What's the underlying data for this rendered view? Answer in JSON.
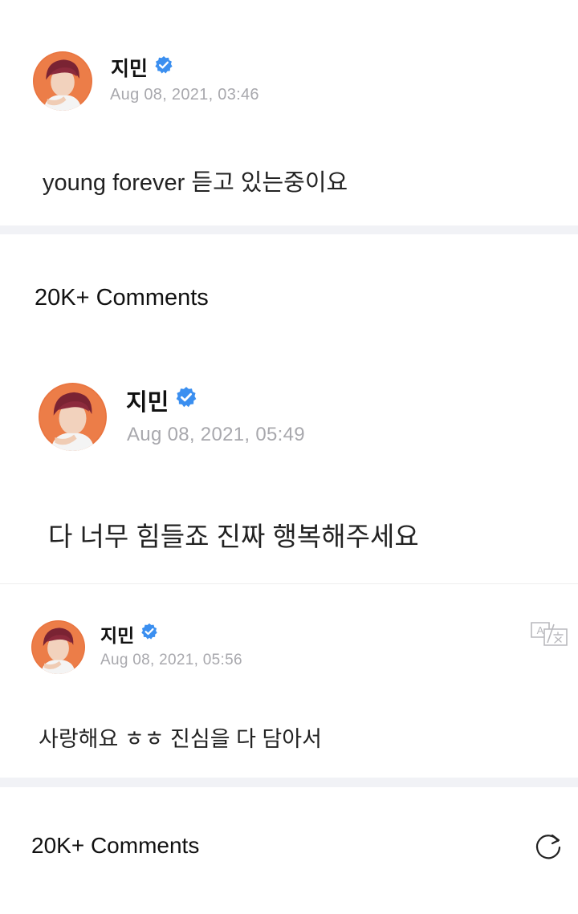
{
  "post": {
    "author": "지민",
    "timestamp": "Aug 08, 2021, 03:46",
    "text": "young forever 듣고 있는중이요"
  },
  "comments_header_1": "20K+ Comments",
  "comment": {
    "author": "지민",
    "timestamp": "Aug 08, 2021, 05:49",
    "text": "다 너무 힘들죠 진짜 행복해주세요"
  },
  "post2": {
    "author": "지민",
    "timestamp": "Aug 08, 2021, 05:56",
    "text": "사랑해요 ㅎㅎ 진심을 다 담아서"
  },
  "comments_header_2": "20K+ Comments",
  "colors": {
    "verified": "#3b8ff0",
    "timestamp": "#a8a8ad",
    "separator": "#f1f2f6",
    "avatar_bg": "#e9743f"
  },
  "icons": {
    "verified": "verified-badge-icon",
    "translate": "translate-icon",
    "refresh": "refresh-icon"
  }
}
